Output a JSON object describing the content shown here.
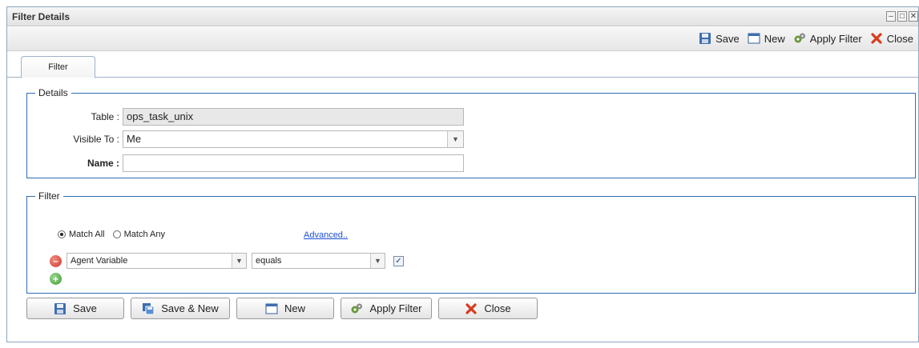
{
  "window": {
    "title": "Filter Details",
    "controls": [
      "–",
      "□",
      "✕"
    ]
  },
  "toolbar": {
    "save": "Save",
    "new": "New",
    "apply_filter": "Apply Filter",
    "close": "Close"
  },
  "tabs": [
    {
      "label": "Filter",
      "active": true
    }
  ],
  "details": {
    "legend": "Details",
    "table": {
      "label": "Table :",
      "value": "ops_task_unix"
    },
    "visible_to": {
      "label": "Visible To :",
      "value": "Me"
    },
    "name": {
      "label": "Name :",
      "value": ""
    }
  },
  "filter": {
    "legend": "Filter",
    "match_all": "Match All",
    "match_any": "Match Any",
    "match_selected": "Match All",
    "advanced_link": "Advanced..",
    "condition": {
      "field": "Agent Variable",
      "operator": "equals",
      "checked": true
    }
  },
  "buttons": {
    "save": "Save",
    "save_new": "Save & New",
    "new": "New",
    "apply_filter": "Apply Filter",
    "close": "Close"
  },
  "icons": {
    "save": "floppy-disk-icon",
    "new": "window-icon",
    "apply_filter": "gears-icon",
    "close": "red-x-icon",
    "remove": "minus-circle-icon",
    "add": "plus-circle-icon"
  },
  "colors": {
    "fieldset_border": "#2e6eb5",
    "link": "#1a4fd6",
    "close_icon": "#d93a1f"
  }
}
